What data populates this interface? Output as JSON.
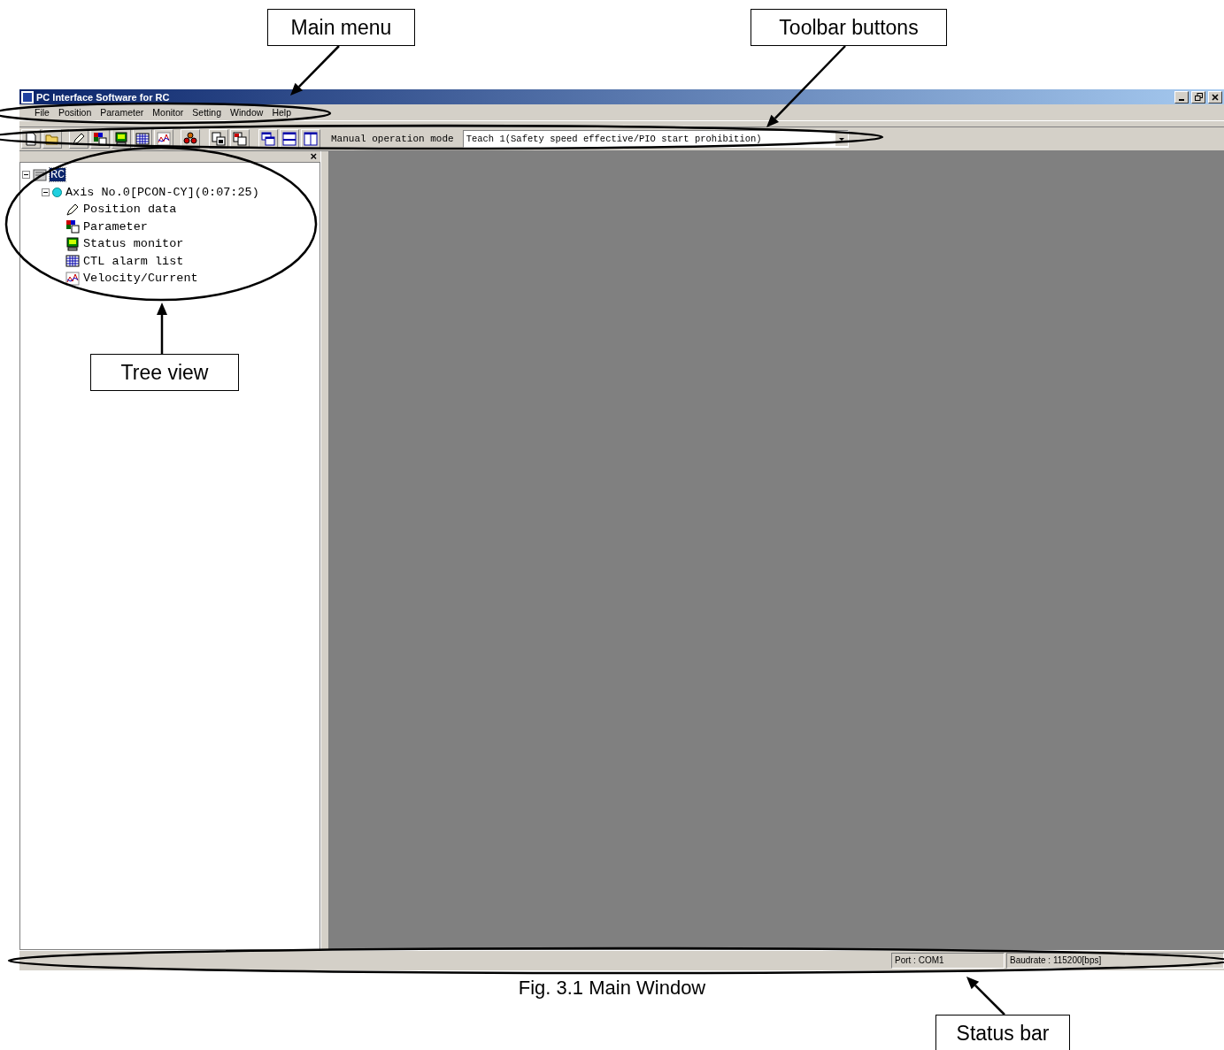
{
  "annotations": [
    {
      "label": "Main menu"
    },
    {
      "label": "Toolbar buttons"
    },
    {
      "label": "Tree view"
    },
    {
      "label": "Status bar"
    }
  ],
  "window": {
    "title": "PC Interface Software for RC"
  },
  "menu": [
    "File",
    "Position",
    "Parameter",
    "Monitor",
    "Setting",
    "Window",
    "Help"
  ],
  "toolbar": {
    "mode_label": "Manual operation mode",
    "mode_select": {
      "value": "Teach 1(Safety speed effective/PIO start prohibition)"
    }
  },
  "tree": {
    "close": "×",
    "root": {
      "label": "RC",
      "selected": true,
      "expanded": true,
      "children": [
        {
          "label": "Axis No.0[PCON-CY](0:07:25)",
          "selected": false,
          "expanded": true,
          "children": [
            {
              "label": "Position data",
              "kind": "pencil",
              "selected": false
            },
            {
              "label": "Parameter",
              "kind": "parameter",
              "selected": false
            },
            {
              "label": "Status monitor",
              "kind": "monitor",
              "selected": false
            },
            {
              "label": "CTL alarm list",
              "kind": "table",
              "selected": false
            },
            {
              "label": "Velocity/Current",
              "kind": "graph",
              "selected": false
            }
          ]
        }
      ]
    }
  },
  "status_bar": {
    "fields": [
      "Port : COM1",
      "Baudrate : 115200[bps]"
    ]
  },
  "caption": "Fig. 3.1 Main Window"
}
